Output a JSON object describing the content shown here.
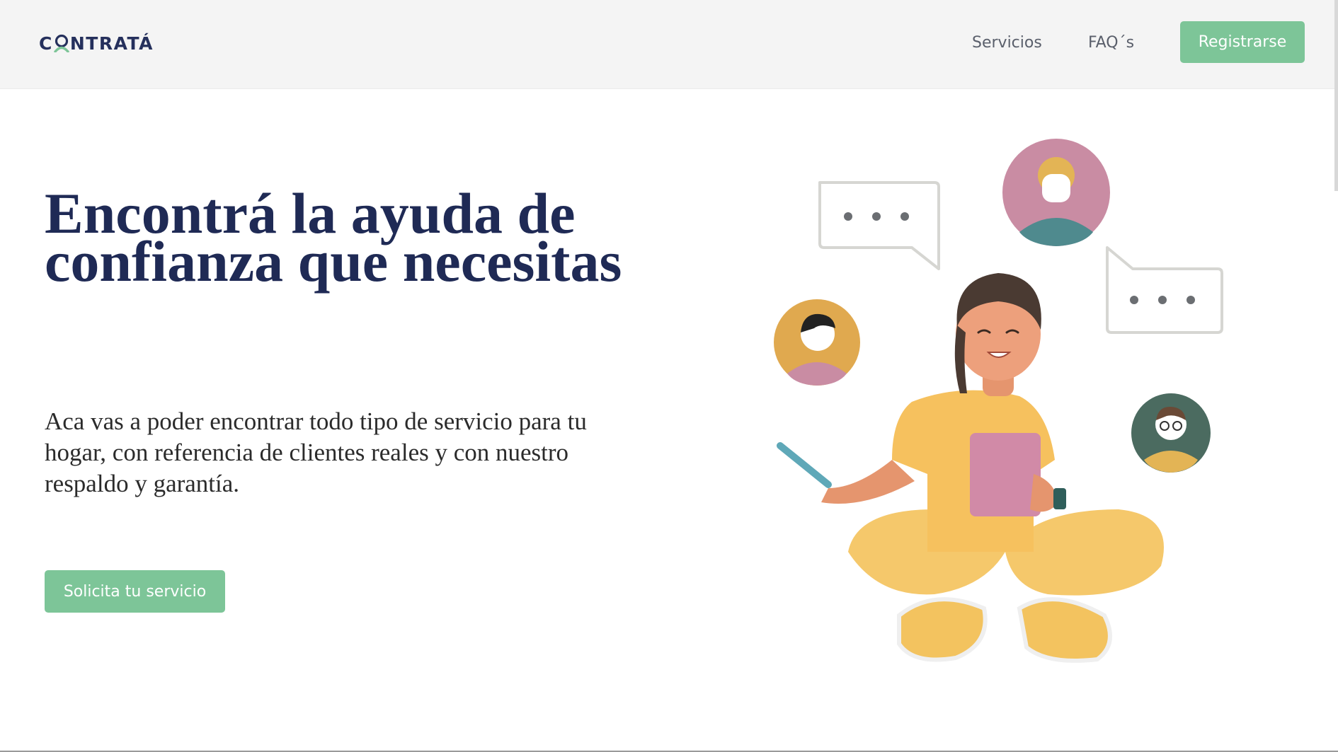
{
  "header": {
    "logo_prefix": "C",
    "logo_suffix": "NTRATÁ",
    "nav": {
      "servicios": "Servicios",
      "faq": "FAQ´s"
    },
    "register_label": "Registrarse"
  },
  "hero": {
    "title": "Encontrá la ayuda de confianza que necesitas",
    "text": "Aca vas a poder encontrar todo tipo de servicio para tu hogar, con referencia de clientes reales y con nuestro respaldo y garantía.",
    "cta_label": "Solicita tu servicio"
  },
  "colors": {
    "accent": "#7dc598",
    "title": "#1f2a55",
    "header_bg": "#f4f4f4"
  },
  "icons": {
    "logo_o": "person-o-icon",
    "illustration": "person-with-tablet-illustration"
  }
}
